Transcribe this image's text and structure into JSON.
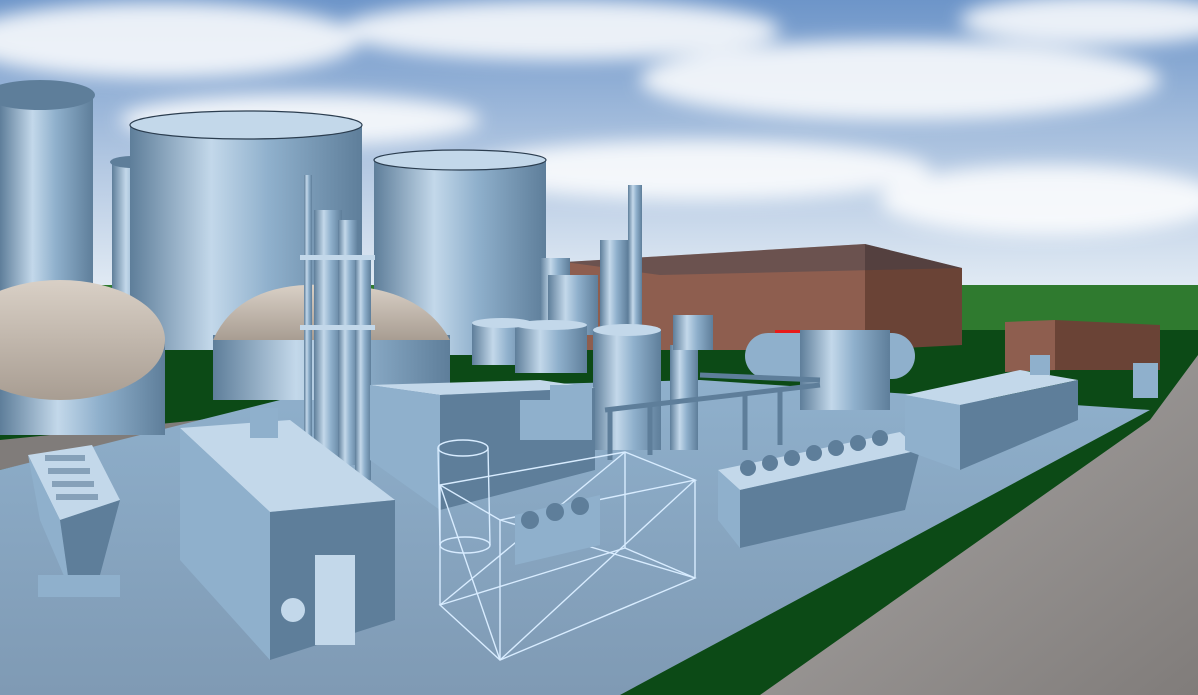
{
  "viewport": {
    "view": "3d-perspective"
  },
  "palette": {
    "sky_top": "#6d95c9",
    "sky_mid": "#b3c8e2",
    "sky_horizon": "#e6eef6",
    "cloud": "#ffffff",
    "grass_far": "#2f7a2f",
    "grass_near": "#0c4a16",
    "road": "#807c7a",
    "road_light": "#aca9a8",
    "plant_floor": "#7f9ab4",
    "equipment_base": "#8fb0cc",
    "equipment_light": "#c3d8ea",
    "equipment_dark": "#5e7e9a",
    "dome_top": "#d9d0c6",
    "dome_shade": "#a89d92",
    "building_brown": "#8e5e4f",
    "building_brown_dark": "#6a4336",
    "hot_spot": "#e81a1a",
    "wireframe": "#d8ecff",
    "edge": "#2b3d4f"
  },
  "scene_objects": [
    "storage-tank",
    "digester-dome",
    "distillation-column",
    "boiler-stack",
    "engine-container",
    "wireframe-enclosure",
    "radiator-cooler-bank",
    "gas-holder-tank",
    "warehouse-building",
    "hopper-feeder",
    "pipe-rack"
  ]
}
